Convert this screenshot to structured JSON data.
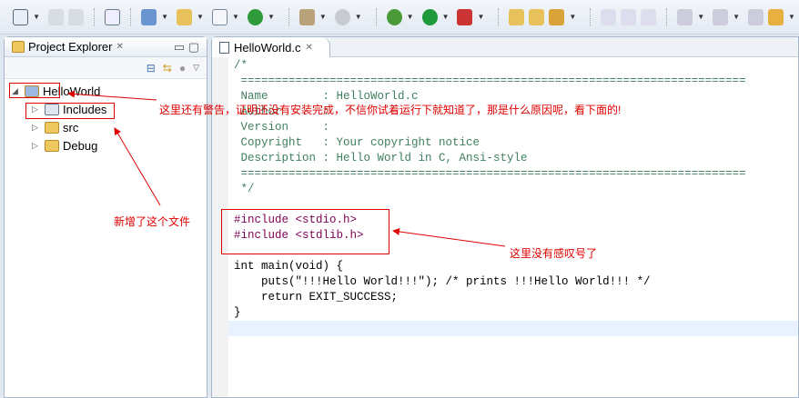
{
  "panel": {
    "title": "Project Explorer",
    "close": "✕",
    "tree": [
      {
        "label": "HelloWorld",
        "expanded": true
      },
      {
        "label": "Includes"
      },
      {
        "label": "src"
      },
      {
        "label": "Debug"
      }
    ]
  },
  "editor": {
    "tab": "HelloWorld.c",
    "close": "✕",
    "lines": [
      "/*",
      " ==========================================================================",
      " Name        : HelloWorld.c",
      " Author      :",
      " Version     :",
      " Copyright   : Your copyright notice",
      " Description : Hello World in C, Ansi-style",
      " ==========================================================================",
      " */",
      "",
      "#include <stdio.h>",
      "#include <stdlib.h>",
      "",
      "int main(void) {",
      "    puts(\"!!!Hello World!!!\"); /* prints !!!Hello World!!! */",
      "    return EXIT_SUCCESS;",
      "}"
    ]
  },
  "annotations": {
    "warning": "这里还有警告，证明还没有安装完成，不信你试着运行下就知道了，那是什么原因呢，看下面的!",
    "new_file": "新增了这个文件",
    "no_bang": "这里没有感叹号了"
  }
}
